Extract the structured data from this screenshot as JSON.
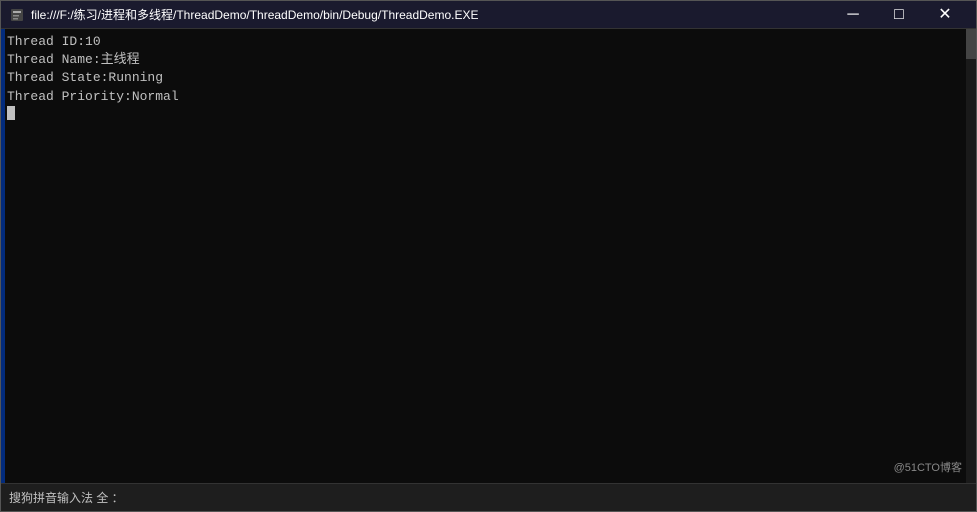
{
  "window": {
    "title": "file:///F:/练习/进程和多线程/ThreadDemo/ThreadDemo/bin/Debug/ThreadDemo.EXE",
    "controls": {
      "minimize": "─",
      "maximize": "□",
      "close": "✕"
    }
  },
  "console": {
    "lines": [
      "Thread ID:10",
      "Thread Name:主线程",
      "Thread State:Running",
      "Thread Priority:Normal"
    ]
  },
  "ime": {
    "text": "搜狗拼音输入法  全  ："
  },
  "watermark": {
    "text": "@51CTO博客"
  }
}
